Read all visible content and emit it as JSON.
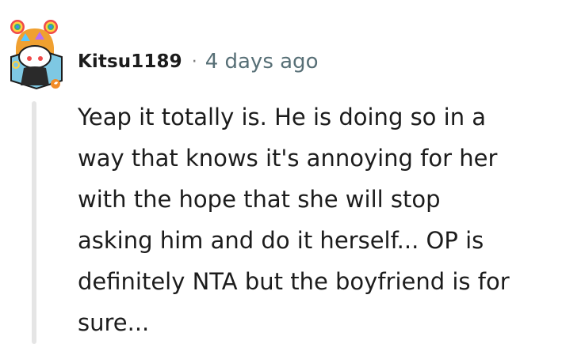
{
  "comment": {
    "username": "Kitsu1189",
    "separator": "·",
    "timestamp": "4 days ago",
    "body_lines": [
      "Yeap it totally is. He is doing so in a",
      "way that knows it's annoying for her",
      "with the hope that she will stop",
      "asking him and do it herself... OP is",
      "definitely NTA but the boyfriend is for",
      "sure..."
    ],
    "avatar": {
      "icon": "snoo-avatar-icon",
      "badge_icon": "leaf-badge-icon"
    }
  },
  "colors": {
    "username": "#1c1c1c",
    "timestamp": "#576f76",
    "thread_line": "#e5e5e5",
    "avatar_background": "#7ec8e3",
    "badge": "#f28c28"
  }
}
